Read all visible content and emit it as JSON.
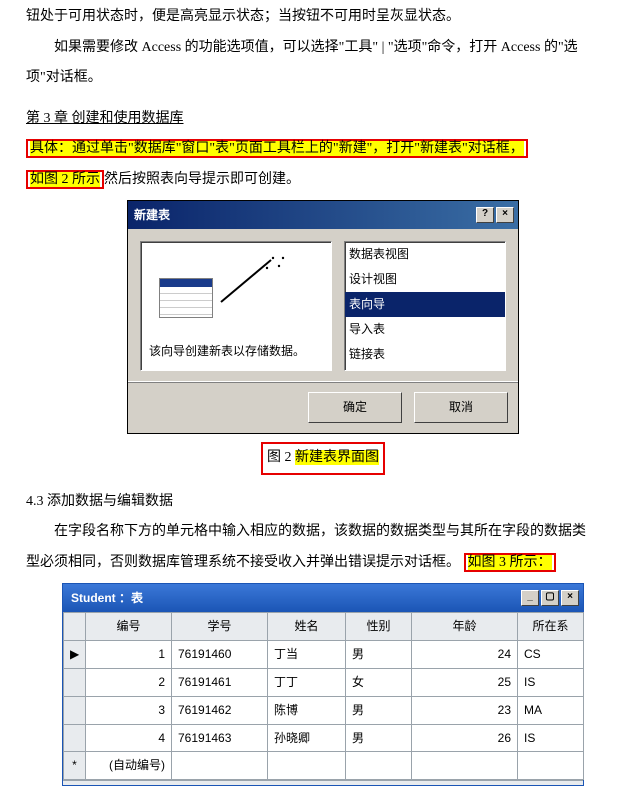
{
  "paragraphs": {
    "p0": "钮处于可用状态时，便是高亮显示状态；当按钮不可用时呈灰显状态。",
    "p1a": "如果需要修改 Access 的功能选项值，可以选择\"工具\" | \"选项\"命令，打开 Access 的\"选",
    "p1b": "项\"对话框。",
    "chapter": "第 3 章  创建和使用数据库",
    "steps_a": "具体：通过单击\"数据库\"窗口\"表\"页面工具栏上的\"新建\"，打开\"新建表\"对话框，",
    "ref1": "如图 2 所示",
    "steps_b": "然后按照表向导提示即可创建。",
    "sec43": "4.3  添加数据与编辑数据",
    "p43a": "在字段名称下方的单元格中输入相应的数据，该数据的数据类型与其所在字段的数据类",
    "p43b": "型必须相同，否则数据库管理系统不接受收入并弹出错误提示对话框。",
    "ref2": "如图 3 所示："
  },
  "dialog": {
    "title": "新建表",
    "help_text": "该向导创建新表以存储数据。",
    "list": [
      "数据表视图",
      "设计视图",
      "表向导",
      "导入表",
      "链接表"
    ],
    "selected_index": 2,
    "ok": "确定",
    "cancel": "取消",
    "caption_prefix": "图 2 ",
    "caption_text": "新建表界面图"
  },
  "student_window": {
    "title": "Student ：表",
    "columns": [
      "编号",
      "学号",
      "姓名",
      "性别",
      "年龄",
      "所在系"
    ],
    "rows": [
      {
        "mark": "▶",
        "id": "1",
        "no": "76191460",
        "name": "丁当",
        "sex": "男",
        "age": "24",
        "dep": "CS"
      },
      {
        "mark": "",
        "id": "2",
        "no": "76191461",
        "name": "丁丁",
        "sex": "女",
        "age": "25",
        "dep": "IS"
      },
      {
        "mark": "",
        "id": "3",
        "no": "76191462",
        "name": "陈博",
        "sex": "男",
        "age": "23",
        "dep": "MA"
      },
      {
        "mark": "",
        "id": "4",
        "no": "76191463",
        "name": "孙晓卿",
        "sex": "男",
        "age": "26",
        "dep": "IS"
      }
    ],
    "autonum": "(自动编号)",
    "new_mark": "*"
  }
}
